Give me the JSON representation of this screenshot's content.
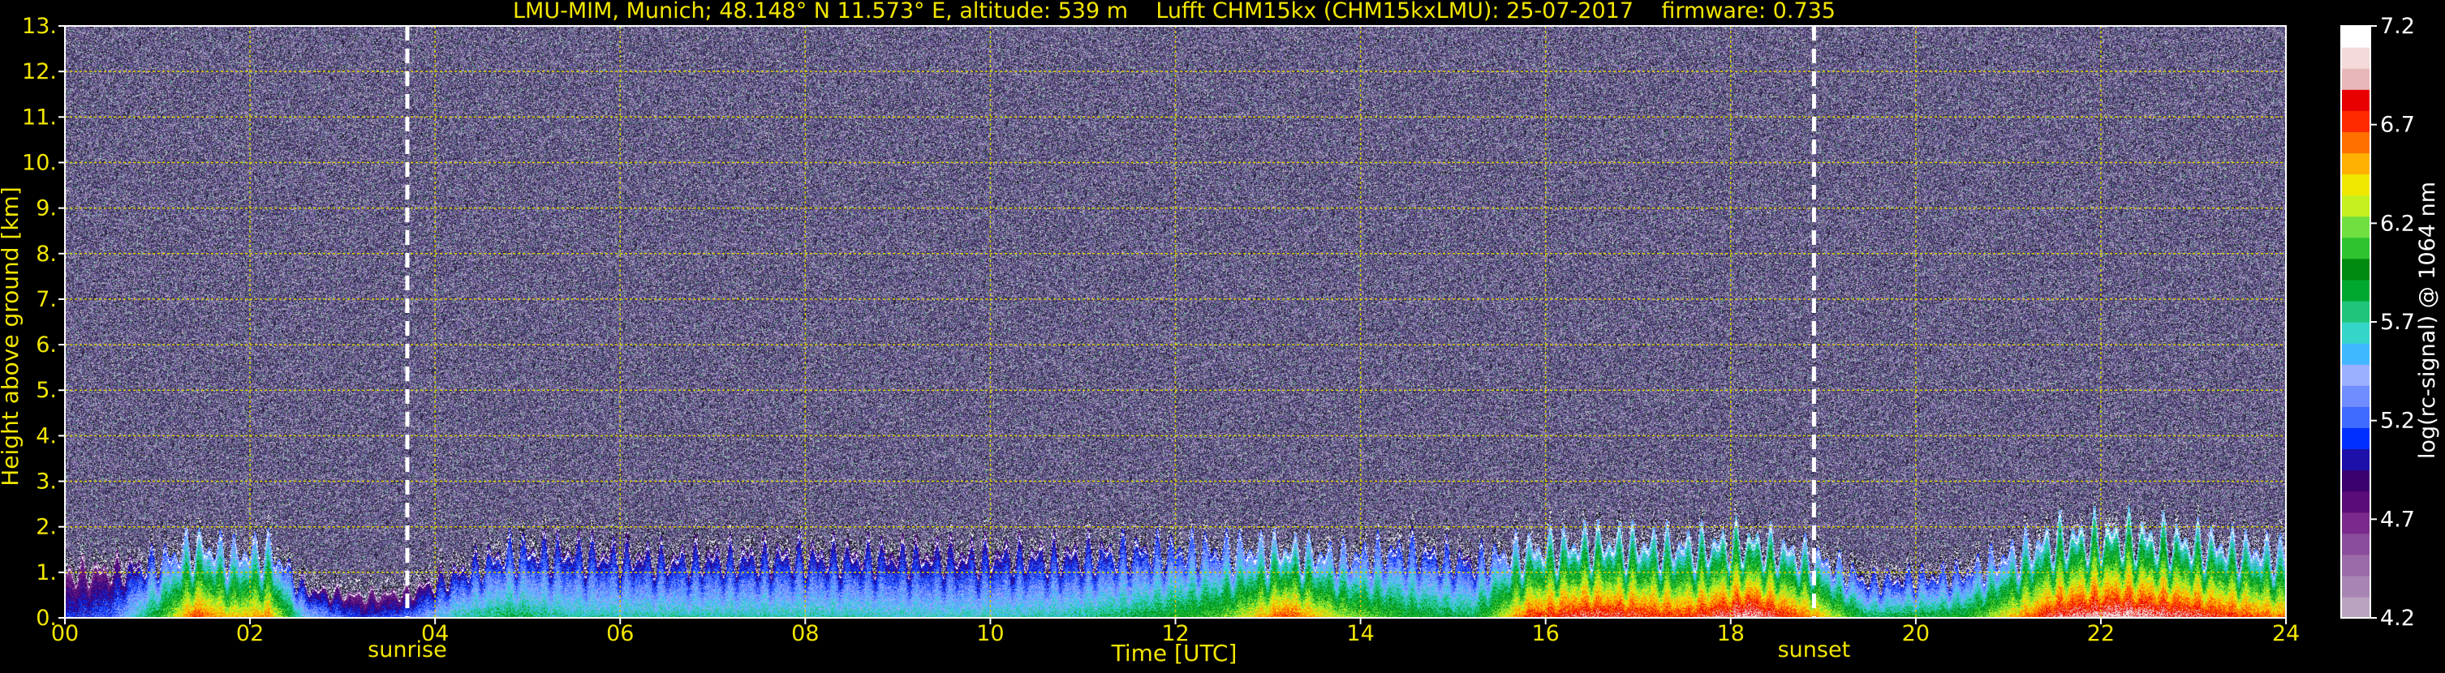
{
  "chart_data": {
    "type": "heatmap",
    "title": "LMU-MIM, Munich; 48.148° N 11.573° E, altitude: 539 m    Lufft CHM15kx (CHM15kxLMU): 25-07-2017    firmware: 0.735",
    "xlabel": "Time [UTC]",
    "ylabel": "Height above ground [km]",
    "xlim": [
      0,
      24
    ],
    "ylim": [
      0,
      13
    ],
    "x_ticks": [
      "00",
      "02",
      "04",
      "06",
      "08",
      "10",
      "12",
      "14",
      "16",
      "18",
      "20",
      "22",
      "24"
    ],
    "x_tick_values": [
      0,
      2,
      4,
      6,
      8,
      10,
      12,
      14,
      16,
      18,
      20,
      22,
      24
    ],
    "y_ticks": [
      "0.",
      "1.",
      "2.",
      "3.",
      "4.",
      "5.",
      "6.",
      "7.",
      "8.",
      "9.",
      "10.",
      "11.",
      "12.",
      "13."
    ],
    "y_tick_values": [
      0,
      1,
      2,
      3,
      4,
      5,
      6,
      7,
      8,
      9,
      10,
      11,
      12,
      13
    ],
    "grid": true,
    "annotations": [
      {
        "text": "sunrise",
        "x": 3.7
      },
      {
        "text": "sunset",
        "x": 18.9
      }
    ],
    "colorbar": {
      "label": "log(rc-signal) @ 1064 nm",
      "range": [
        4.2,
        7.2
      ],
      "ticks": [
        "7.2",
        "6.7",
        "6.2",
        "5.7",
        "5.2",
        "4.7",
        "4.2"
      ],
      "tick_values": [
        7.2,
        6.7,
        6.2,
        5.7,
        5.2,
        4.7,
        4.2
      ],
      "colors": [
        "#b9a3c0",
        "#a884b3",
        "#9b6aa8",
        "#8a4c9c",
        "#7a2a8c",
        "#5a0d78",
        "#3a006e",
        "#1c10a8",
        "#0030ff",
        "#3f6bff",
        "#6f8dff",
        "#9bb0ff",
        "#40b8ff",
        "#35d6c9",
        "#20c47a",
        "#00a830",
        "#008a10",
        "#2ec430",
        "#6fe040",
        "#c6f020",
        "#f0e800",
        "#ffb000",
        "#ff7000",
        "#ff2a00",
        "#e80000",
        "#e8b8b8",
        "#f4dada",
        "#ffffff"
      ]
    },
    "time_profile": [
      {
        "t": 0.0,
        "pbl": 1.2,
        "intensity": 0.3
      },
      {
        "t": 0.5,
        "pbl": 1.3,
        "intensity": 0.35
      },
      {
        "t": 1.0,
        "pbl": 1.5,
        "intensity": 0.6
      },
      {
        "t": 1.4,
        "pbl": 1.9,
        "intensity": 0.85
      },
      {
        "t": 1.8,
        "pbl": 1.7,
        "intensity": 0.75
      },
      {
        "t": 2.2,
        "pbl": 1.8,
        "intensity": 0.8
      },
      {
        "t": 2.6,
        "pbl": 0.8,
        "intensity": 0.45
      },
      {
        "t": 3.2,
        "pbl": 0.6,
        "intensity": 0.3
      },
      {
        "t": 3.7,
        "pbl": 0.7,
        "intensity": 0.35
      },
      {
        "t": 4.2,
        "pbl": 1.2,
        "intensity": 0.5
      },
      {
        "t": 4.8,
        "pbl": 1.8,
        "intensity": 0.55
      },
      {
        "t": 5.5,
        "pbl": 1.8,
        "intensity": 0.5
      },
      {
        "t": 6.5,
        "pbl": 1.6,
        "intensity": 0.5
      },
      {
        "t": 8.0,
        "pbl": 1.7,
        "intensity": 0.5
      },
      {
        "t": 9.5,
        "pbl": 1.7,
        "intensity": 0.48
      },
      {
        "t": 10.8,
        "pbl": 1.7,
        "intensity": 0.5
      },
      {
        "t": 11.5,
        "pbl": 1.8,
        "intensity": 0.55
      },
      {
        "t": 12.5,
        "pbl": 1.8,
        "intensity": 0.65
      },
      {
        "t": 13.2,
        "pbl": 1.8,
        "intensity": 0.85
      },
      {
        "t": 13.8,
        "pbl": 1.6,
        "intensity": 0.7
      },
      {
        "t": 14.5,
        "pbl": 1.8,
        "intensity": 0.6
      },
      {
        "t": 15.2,
        "pbl": 1.5,
        "intensity": 0.55
      },
      {
        "t": 15.8,
        "pbl": 1.8,
        "intensity": 0.85
      },
      {
        "t": 16.5,
        "pbl": 2.0,
        "intensity": 0.9
      },
      {
        "t": 17.5,
        "pbl": 1.9,
        "intensity": 0.85
      },
      {
        "t": 18.2,
        "pbl": 2.0,
        "intensity": 0.95
      },
      {
        "t": 18.9,
        "pbl": 1.6,
        "intensity": 0.8
      },
      {
        "t": 19.5,
        "pbl": 1.0,
        "intensity": 0.55
      },
      {
        "t": 20.5,
        "pbl": 1.2,
        "intensity": 0.6
      },
      {
        "t": 21.5,
        "pbl": 2.1,
        "intensity": 0.9
      },
      {
        "t": 22.2,
        "pbl": 2.2,
        "intensity": 0.95
      },
      {
        "t": 23.0,
        "pbl": 2.0,
        "intensity": 0.9
      },
      {
        "t": 24.0,
        "pbl": 1.7,
        "intensity": 0.8
      }
    ]
  }
}
